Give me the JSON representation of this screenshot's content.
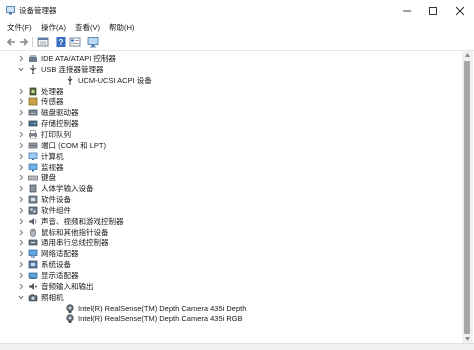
{
  "window": {
    "title": "设备管理器",
    "controls": {
      "minimize": "minimize-icon",
      "maximize": "maximize-icon",
      "close": "close-icon"
    }
  },
  "menu": [
    {
      "label": "文件(F)"
    },
    {
      "label": "操作(A)"
    },
    {
      "label": "查看(V)"
    },
    {
      "label": "帮助(H)"
    }
  ],
  "toolbar": [
    "back-arrow-icon",
    "forward-arrow-icon",
    "properties-view-icon",
    "help-icon",
    "view-list-icon",
    "monitor-icon"
  ],
  "tree": [
    {
      "label": "IDE ATA/ATAPI 控制器",
      "state": "collapsed",
      "icon": "ide-controller-icon",
      "level": 0
    },
    {
      "label": "USB 连接器管理器",
      "state": "expanded",
      "icon": "usb-icon",
      "level": 0
    },
    {
      "label": "UCM-UCSI ACPI 设备",
      "state": "leaf",
      "icon": "usb-device-icon",
      "level": 1
    },
    {
      "label": "处理器",
      "state": "collapsed",
      "icon": "processor-icon",
      "level": 0
    },
    {
      "label": "传感器",
      "state": "collapsed",
      "icon": "sensor-icon",
      "level": 0
    },
    {
      "label": "磁盘驱动器",
      "state": "collapsed",
      "icon": "disk-drive-icon",
      "level": 0
    },
    {
      "label": "存储控制器",
      "state": "collapsed",
      "icon": "storage-controller-icon",
      "level": 0
    },
    {
      "label": "打印队列",
      "state": "collapsed",
      "icon": "printer-icon",
      "level": 0
    },
    {
      "label": "端口 (COM 和 LPT)",
      "state": "collapsed",
      "icon": "port-icon",
      "level": 0
    },
    {
      "label": "计算机",
      "state": "collapsed",
      "icon": "computer-icon",
      "level": 0
    },
    {
      "label": "监视器",
      "state": "collapsed",
      "icon": "monitor-icon",
      "level": 0
    },
    {
      "label": "键盘",
      "state": "collapsed",
      "icon": "keyboard-icon",
      "level": 0
    },
    {
      "label": "人体学输入设备",
      "state": "collapsed",
      "icon": "hid-icon",
      "level": 0
    },
    {
      "label": "软件设备",
      "state": "collapsed",
      "icon": "software-device-icon",
      "level": 0
    },
    {
      "label": "软件组件",
      "state": "collapsed",
      "icon": "software-component-icon",
      "level": 0
    },
    {
      "label": "声音、视频和游戏控制器",
      "state": "collapsed",
      "icon": "sound-icon",
      "level": 0
    },
    {
      "label": "鼠标和其他指针设备",
      "state": "collapsed",
      "icon": "mouse-icon",
      "level": 0
    },
    {
      "label": "通用串行总线控制器",
      "state": "collapsed",
      "icon": "usb-controller-icon",
      "level": 0
    },
    {
      "label": "网络适配器",
      "state": "collapsed",
      "icon": "network-adapter-icon",
      "level": 0
    },
    {
      "label": "系统设备",
      "state": "collapsed",
      "icon": "system-device-icon",
      "level": 0
    },
    {
      "label": "显示适配器",
      "state": "collapsed",
      "icon": "display-adapter-icon",
      "level": 0
    },
    {
      "label": "音频输入和输出",
      "state": "collapsed",
      "icon": "audio-io-icon",
      "level": 0
    },
    {
      "label": "照相机",
      "state": "expanded",
      "icon": "camera-icon",
      "level": 0
    },
    {
      "label": "Intel(R) RealSense(TM) Depth Camera 435i Depth",
      "state": "leaf",
      "icon": "webcam-icon",
      "level": 1
    },
    {
      "label": "Intel(R) RealSense(TM) Depth Camera 435i RGB",
      "state": "leaf",
      "icon": "webcam-icon",
      "level": 1
    }
  ]
}
